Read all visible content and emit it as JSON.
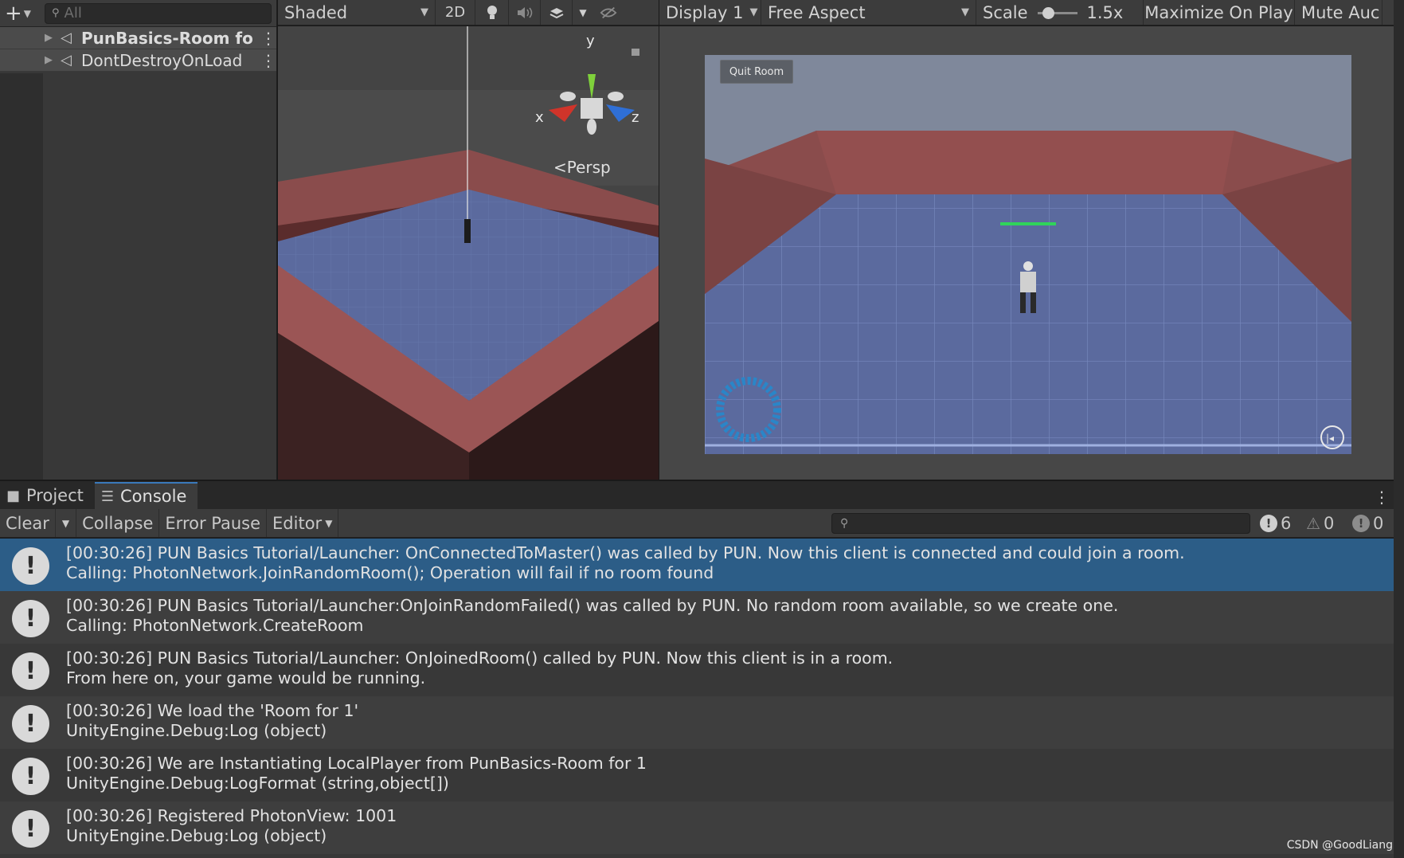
{
  "hierarchy": {
    "search_placeholder": "All",
    "items": [
      {
        "label": "PunBasics-Room fo",
        "bold": true
      },
      {
        "label": "DontDestroyOnLoad",
        "bold": false
      }
    ]
  },
  "scene": {
    "shading_mode": "Shaded",
    "mode_2d": "2D",
    "gizmo": {
      "y": "y",
      "x": "x",
      "z": "z",
      "projection": "Persp"
    }
  },
  "game": {
    "display": "Display 1",
    "aspect": "Free Aspect",
    "scale_label": "Scale",
    "scale_value": "1.5x",
    "maximize": "Maximize On Play",
    "mute": "Mute Auc",
    "quit_button": "Quit Room"
  },
  "console_tabs": {
    "project": "Project",
    "console": "Console"
  },
  "console_toolbar": {
    "clear": "Clear",
    "collapse": "Collapse",
    "error_pause": "Error Pause",
    "editor": "Editor",
    "info_count": "6",
    "warn_count": "0",
    "error_count": "0"
  },
  "logs": [
    {
      "line1": "[00:30:26] PUN Basics Tutorial/Launcher: OnConnectedToMaster() was called by PUN. Now this client is connected and could join a room.",
      "line2": "Calling: PhotonNetwork.JoinRandomRoom(); Operation will fail if no room found"
    },
    {
      "line1": "[00:30:26] PUN Basics Tutorial/Launcher:OnJoinRandomFailed() was called by PUN. No random room available, so we create one.",
      "line2": "Calling: PhotonNetwork.CreateRoom"
    },
    {
      "line1": "[00:30:26] PUN Basics Tutorial/Launcher: OnJoinedRoom() called by PUN. Now this client is in a room.",
      "line2": "From here on, your game would be running."
    },
    {
      "line1": "[00:30:26] We load the 'Room for 1'",
      "line2": "UnityEngine.Debug:Log (object)"
    },
    {
      "line1": "[00:30:26] We are Instantiating LocalPlayer from PunBasics-Room for 1",
      "line2": "UnityEngine.Debug:LogFormat (string,object[])"
    },
    {
      "line1": "[00:30:26] Registered PhotonView: 1001",
      "line2": "UnityEngine.Debug:Log (object)"
    }
  ],
  "watermark": "CSDN @GoodLiang",
  "colors": {
    "selected_row": "#2c5d87",
    "active_tab": "#3a79bb",
    "floor": "#5b6a9e",
    "wall": "#8a4c4c",
    "gizmo_y": "#7fd13b",
    "gizmo_x": "#d0342a",
    "gizmo_z": "#2f6fd6",
    "sky": "#7f889b"
  }
}
